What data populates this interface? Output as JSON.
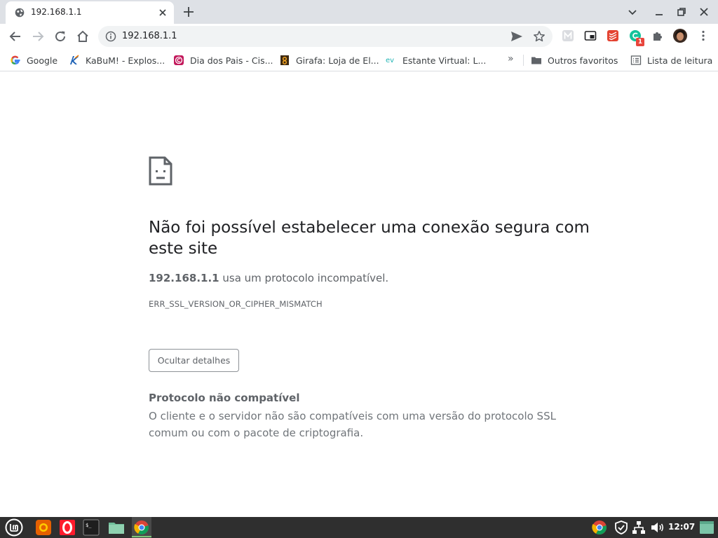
{
  "tab": {
    "title": "192.168.1.1",
    "favicon": "globe-icon"
  },
  "toolbar": {
    "url": "192.168.1.1",
    "avatar": "profile-avatar"
  },
  "bookmarks": [
    {
      "label": "Google",
      "icon": "google-icon"
    },
    {
      "label": "KaBuM! - Explos...",
      "icon": "kabum-icon"
    },
    {
      "label": "Dia dos Pais - Cis...",
      "icon": "cissa-icon"
    },
    {
      "label": "Girafa: Loja de El...",
      "icon": "girafa-icon"
    },
    {
      "label": "Estante Virtual: L...",
      "icon": "estante-virtual-icon"
    }
  ],
  "bookmarks_more": "»",
  "bookmarks_folder": {
    "label": "Outros favoritos",
    "icon": "folder-icon"
  },
  "reading_list": {
    "label": "Lista de leitura",
    "icon": "reading-list-icon"
  },
  "error": {
    "title": "Não foi possível estabelecer uma conexão segura com este site",
    "host": "192.168.1.1",
    "description": "usa um protocolo incompatível.",
    "code": "ERR_SSL_VERSION_OR_CIPHER_MISMATCH",
    "details_button": "Ocultar detalhes",
    "details_title": "Protocolo não compatível",
    "details_text": "O cliente e o servidor não são compatíveis com uma versão do protocolo SSL comum ou com o pacote de criptografia."
  },
  "extensions": {
    "badge_count": "1"
  },
  "taskbar": {
    "clock": "12:07"
  },
  "colors": {
    "tab_strip": "#dee1e6",
    "omnibox": "#f1f3f4",
    "taskbar": "#2f2f2f",
    "text_primary": "#202124",
    "text_secondary": "#5f6368"
  }
}
